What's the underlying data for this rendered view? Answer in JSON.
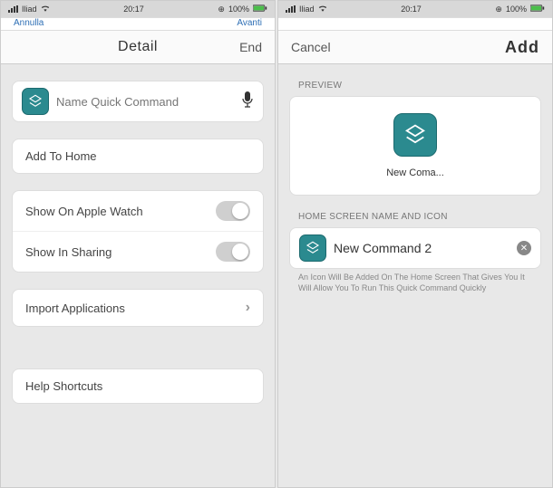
{
  "left": {
    "status": {
      "carrier": "Iliad",
      "time": "20:17",
      "battery": "100%"
    },
    "cutoff": {
      "left": "Annulla",
      "right": "Avanti"
    },
    "nav": {
      "title": "Detail",
      "right": "End"
    },
    "name_section": {
      "placeholder": "Name Quick Command"
    },
    "add_home_label": "Add To Home",
    "toggles": {
      "apple_watch": "Show On Apple Watch",
      "sharing": "Show In Sharing"
    },
    "import_label": "Import Applications",
    "help_label": "Help Shortcuts"
  },
  "right": {
    "status": {
      "carrier": "Iliad",
      "time": "20:17",
      "battery": "100%"
    },
    "nav": {
      "left": "Cancel",
      "right": "Add"
    },
    "preview_header": "PREVIEW",
    "preview_label": "New Coma...",
    "home_section_header": "HOME SCREEN NAME AND ICON",
    "home_name": "New Command 2",
    "helper": "An Icon Will Be Added On The Home Screen That Gives You It Will Allow You To Run This Quick Command Quickly"
  }
}
